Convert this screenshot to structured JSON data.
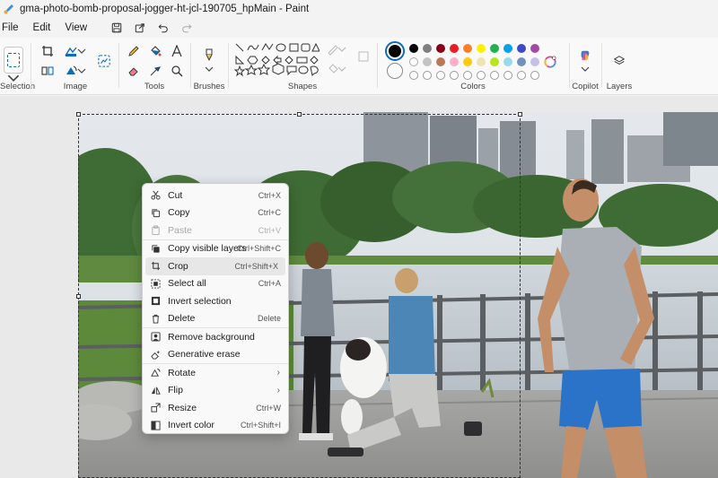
{
  "window": {
    "title": "gma-photo-bomb-proposal-jogger-ht-jcl-190705_hpMain - Paint"
  },
  "menu": {
    "file": "File",
    "edit": "Edit",
    "view": "View"
  },
  "ribbon": {
    "groups": {
      "selection": "Selection",
      "image": "Image",
      "tools": "Tools",
      "brushes": "Brushes",
      "shapes": "Shapes",
      "colors": "Colors",
      "copilot": "Copilot",
      "layers": "Layers"
    }
  },
  "colors": {
    "primary": "#000000",
    "secondary": "#ffffff",
    "row1": [
      "#000000",
      "#7f7f7f",
      "#880015",
      "#ed1c24",
      "#ff7f27",
      "#fff200",
      "#22b14c",
      "#00a2e8",
      "#3f48cc",
      "#a349a4"
    ],
    "row2": [
      "#ffffff",
      "#c3c3c3",
      "#b97a57",
      "#ffaec9",
      "#ffc90e",
      "#efe4b0",
      "#b5e61d",
      "#99d9ea",
      "#7092be",
      "#c8bfe7"
    ]
  },
  "context_menu": {
    "items": [
      {
        "label": "Cut",
        "shortcut": "Ctrl+X"
      },
      {
        "label": "Copy",
        "shortcut": "Ctrl+C"
      },
      {
        "label": "Paste",
        "shortcut": "Ctrl+V"
      },
      {
        "label": "Copy visible layers",
        "shortcut": "Ctrl+Shift+C"
      },
      {
        "label": "Crop",
        "shortcut": "Ctrl+Shift+X"
      },
      {
        "label": "Select all",
        "shortcut": "Ctrl+A"
      },
      {
        "label": "Invert selection",
        "shortcut": ""
      },
      {
        "label": "Delete",
        "shortcut": "Delete"
      },
      {
        "label": "Remove background",
        "shortcut": ""
      },
      {
        "label": "Generative erase",
        "shortcut": ""
      },
      {
        "label": "Rotate",
        "shortcut": ""
      },
      {
        "label": "Flip",
        "shortcut": ""
      },
      {
        "label": "Resize",
        "shortcut": "Ctrl+W"
      },
      {
        "label": "Invert color",
        "shortcut": "Ctrl+Shift+I"
      }
    ]
  }
}
